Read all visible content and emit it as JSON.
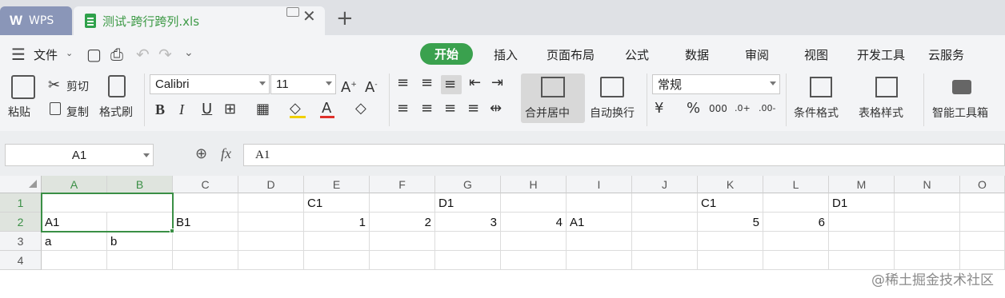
{
  "tabs": {
    "app": "WPS",
    "file": "测试-跨行跨列.xls",
    "new_tab": "+"
  },
  "menu": {
    "file": "文件",
    "tabs": [
      "开始",
      "插入",
      "页面布局",
      "公式",
      "数据",
      "审阅",
      "视图",
      "开发工具",
      "云服务"
    ]
  },
  "ribbon": {
    "paste": "粘贴",
    "cut": "剪切",
    "copy": "复制",
    "format_painter": "格式刷",
    "font_name": "Calibri",
    "font_size": "11",
    "merge_center": "合并居中",
    "wrap_text": "自动换行",
    "number_format": "常规",
    "conditional_format": "条件格式",
    "table_style": "表格样式",
    "smart_tools": "智能工具箱"
  },
  "formula_bar": {
    "name_box": "A1",
    "fx": "fx",
    "content": "A1"
  },
  "grid": {
    "columns": [
      "A",
      "B",
      "C",
      "D",
      "E",
      "F",
      "G",
      "H",
      "I",
      "J",
      "K",
      "L",
      "M",
      "N",
      "O"
    ],
    "rows": [
      "1",
      "2",
      "3",
      "4"
    ],
    "cells": {
      "E1": "C1",
      "G1": "D1",
      "K1": "C1",
      "M1": "D1",
      "A2": "A1",
      "C2": "B1",
      "E2": "1",
      "F2": "2",
      "G2": "3",
      "H2": "4",
      "I2": "A1",
      "K2": "5",
      "L2": "6",
      "A3": "a",
      "B3": "b"
    }
  },
  "watermark": "@稀土掘金技术社区",
  "colors": {
    "accent": "#3aa14e",
    "selection": "#3a8f45",
    "wps_tab": "#8a96b8"
  }
}
